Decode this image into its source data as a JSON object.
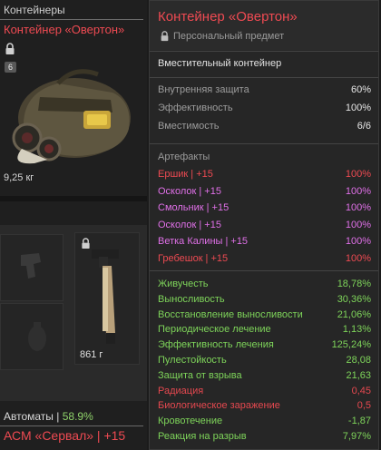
{
  "inventory": {
    "category": "Контейнеры",
    "item_name": "Контейнер «Овертон»",
    "badge_count": "6",
    "weight": "9,25 кг",
    "weapon_weight": "861 г",
    "auto_label": "Автоматы | ",
    "auto_pct": "58.9%",
    "weapon_name": "АСМ «Сервал» | +15"
  },
  "tooltip": {
    "title": "Контейнер «Овертон»",
    "subtitle": "Персональный предмет",
    "type": "Вместительный контейнер",
    "props": [
      {
        "label": "Внутренняя защита",
        "value": "60%"
      },
      {
        "label": "Эффективность",
        "value": "100%"
      },
      {
        "label": "Вместимость",
        "value": "6/6"
      }
    ],
    "artifacts_title": "Артефакты",
    "artifacts": [
      {
        "label": "Ершик | +15",
        "value": "100%",
        "color": "red"
      },
      {
        "label": "Осколок | +15",
        "value": "100%",
        "color": "pink"
      },
      {
        "label": "Смольник | +15",
        "value": "100%",
        "color": "pink"
      },
      {
        "label": "Осколок | +15",
        "value": "100%",
        "color": "pink"
      },
      {
        "label": "Ветка Калины | +15",
        "value": "100%",
        "color": "pink"
      },
      {
        "label": "Гребешок | +15",
        "value": "100%",
        "color": "red"
      }
    ],
    "stats": [
      {
        "label": "Живучесть",
        "value": "18,78%",
        "color": "green"
      },
      {
        "label": "Выносливость",
        "value": "30,36%",
        "color": "green"
      },
      {
        "label": "Восстановление выносливости",
        "value": "21,06%",
        "color": "green"
      },
      {
        "label": "Периодическое лечение",
        "value": "1,13%",
        "color": "green"
      },
      {
        "label": "Эффективность лечения",
        "value": "125,24%",
        "color": "green"
      },
      {
        "label": "Пулестойкость",
        "value": "28,08",
        "color": "green"
      },
      {
        "label": "Защита от взрыва",
        "value": "21,63",
        "color": "green"
      },
      {
        "label": "Радиация",
        "value": "0,45",
        "color": "red"
      },
      {
        "label": "Биологическое заражение",
        "value": "0,5",
        "color": "red"
      },
      {
        "label": "Кровотечение",
        "value": "-1,87",
        "color": "green"
      },
      {
        "label": "Реакция на разрыв",
        "value": "7,97%",
        "color": "green"
      }
    ]
  },
  "colors": {
    "accent_red": "#ee4a52",
    "pink": "#e070e8",
    "green": "#7ed45a",
    "gray": "#9c9c9c"
  }
}
